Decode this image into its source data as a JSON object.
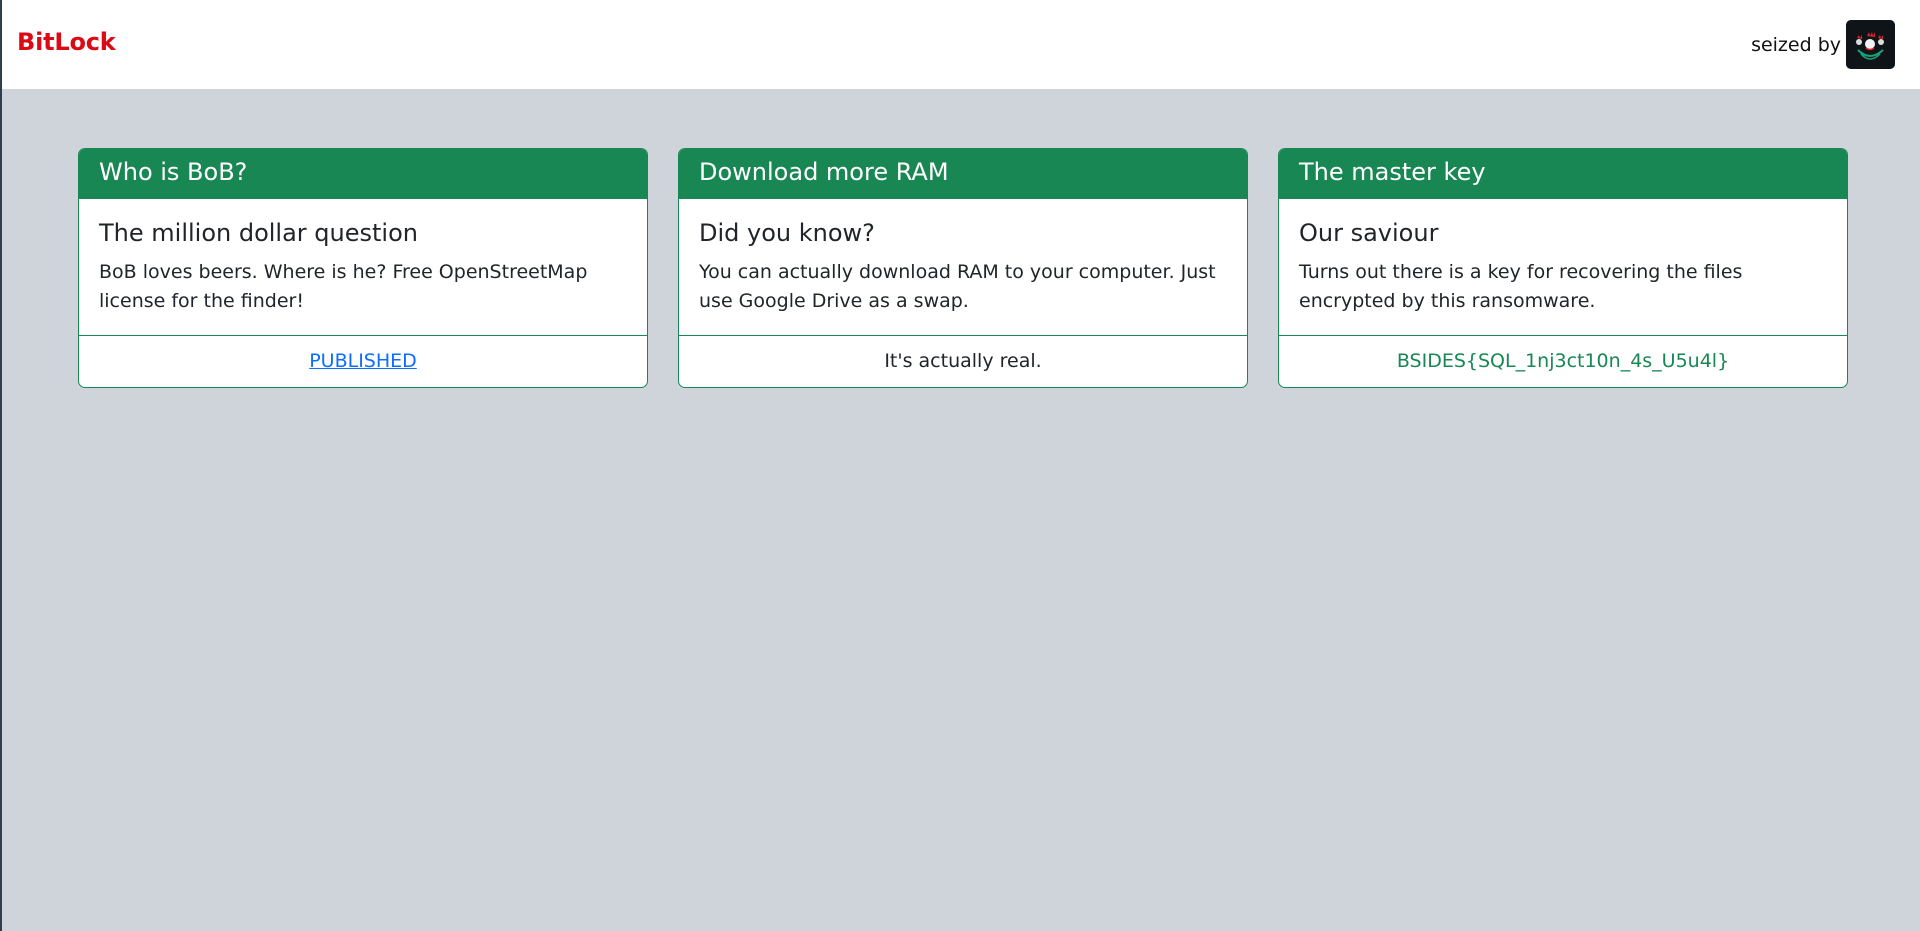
{
  "navbar": {
    "brand": "BitLock",
    "seized_text": "seized by",
    "logo_icon": "rooster-logo-icon"
  },
  "colors": {
    "brand": "#dc0a14",
    "accent": "#198754",
    "background": "#ced4da",
    "link": "#0d6efd"
  },
  "cards": [
    {
      "header": "Who is BoB?",
      "title": "The million dollar question",
      "text": "BoB loves beers. Where is he? Free OpenStreetMap license for the finder!",
      "footer": "PUBLISHED"
    },
    {
      "header": "Download more RAM",
      "title": "Did you know?",
      "text": "You can actually download RAM to your computer. Just use Google Drive as a swap.",
      "footer": "It's actually real."
    },
    {
      "header": "The master key",
      "title": "Our saviour",
      "text": "Turns out there is a key for recovering the files encrypted by this ransomware.",
      "footer": "BSIDES{SQL_1nj3ct10n_4s_U5u4l}"
    }
  ]
}
